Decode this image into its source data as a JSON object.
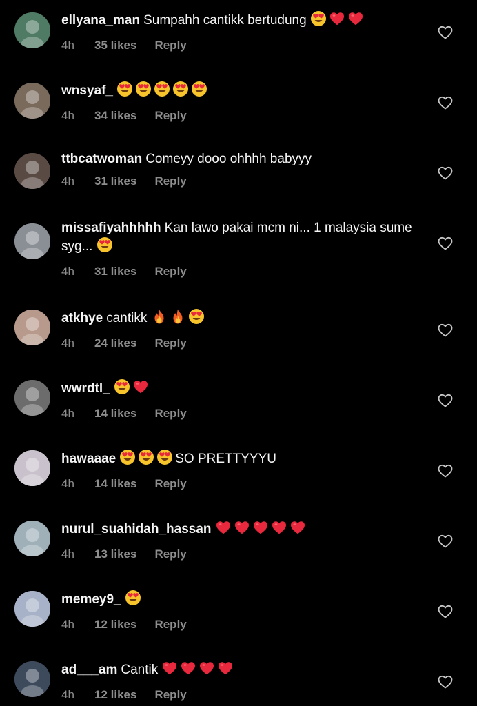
{
  "colors": {
    "background": "#000000",
    "text": "#f5f5f5",
    "meta_text": "#8e8e8e",
    "heart_emoji": "#e8283c",
    "heart_eyes_face": "#f7c52b",
    "like_icon_stroke": "#c7c7c7"
  },
  "icons": {
    "like": "heart-outline-icon",
    "heart_emoji": "red-heart-emoji",
    "heart_eyes_emoji": "heart-eyes-emoji",
    "fire_emoji": "fire-emoji"
  },
  "comments": [
    {
      "username": "ellyana_man",
      "text": "Sumpahh cantikk bertudung",
      "emojis": [
        "heart_eyes",
        "heart",
        "heart"
      ],
      "time": "4h",
      "likes": "35 likes",
      "reply": "Reply",
      "avatar_color": "#4f7a63"
    },
    {
      "username": "wnsyaf_",
      "text": "",
      "emojis": [
        "heart_eyes",
        "heart_eyes",
        "heart_eyes",
        "heart_eyes",
        "heart_eyes"
      ],
      "time": "4h",
      "likes": "34 likes",
      "reply": "Reply",
      "avatar_color": "#7a6a5c"
    },
    {
      "username": "ttbcatwoman",
      "text": "Comeyy dooo ohhhh babyyy",
      "emojis": [],
      "time": "4h",
      "likes": "31 likes",
      "reply": "Reply",
      "avatar_color": "#5a4a44"
    },
    {
      "username": "missafiyahhhhh",
      "text": "Kan lawo pakai mcm ni... 1 malaysia sume syg...",
      "emojis": [
        "heart_eyes"
      ],
      "time": "4h",
      "likes": "31 likes",
      "reply": "Reply",
      "avatar_color": "#8a8f96"
    },
    {
      "username": "atkhye",
      "text": "cantikk",
      "emojis": [
        "fire",
        "fire",
        "heart_eyes"
      ],
      "time": "4h",
      "likes": "24 likes",
      "reply": "Reply",
      "avatar_color": "#b89a8c"
    },
    {
      "username": "wwrdtl_",
      "text": "",
      "emojis": [
        "heart_eyes",
        "heart"
      ],
      "time": "4h",
      "likes": "14 likes",
      "reply": "Reply",
      "avatar_color": "#6c6c6c"
    },
    {
      "username": "hawaaae",
      "text": "SO PRETTYYYU",
      "emojis_before_text": [
        "heart_eyes",
        "heart_eyes",
        "heart_eyes"
      ],
      "emojis": [],
      "time": "4h",
      "likes": "14 likes",
      "reply": "Reply",
      "avatar_color": "#c9c2cc"
    },
    {
      "username": "nurul_suahidah_hassan",
      "text": "",
      "emojis": [
        "heart",
        "heart",
        "heart",
        "heart",
        "heart"
      ],
      "time": "4h",
      "likes": "13 likes",
      "reply": "Reply",
      "avatar_color": "#9fb0b8"
    },
    {
      "username": "memey9_",
      "text": "",
      "emojis": [
        "heart_eyes"
      ],
      "time": "4h",
      "likes": "12 likes",
      "reply": "Reply",
      "avatar_color": "#a7b2c8"
    },
    {
      "username": "ad___am",
      "text": "Cantik",
      "emojis": [
        "heart",
        "heart",
        "heart",
        "heart"
      ],
      "time": "4h",
      "likes": "12 likes",
      "reply": "Reply",
      "avatar_color": "#3d4a5c"
    }
  ]
}
